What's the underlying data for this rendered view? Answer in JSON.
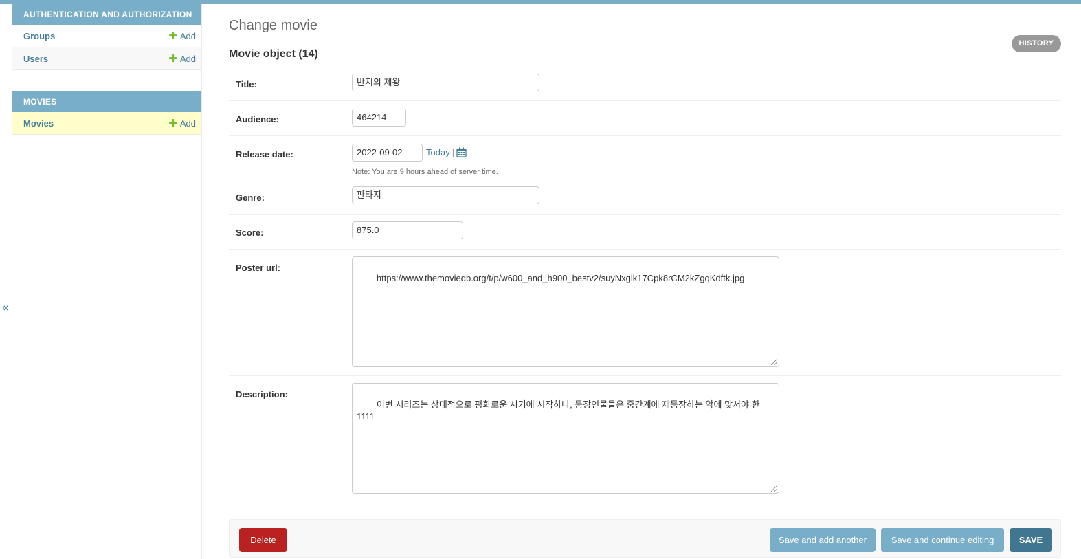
{
  "sidebar": {
    "collapse_glyph": "«",
    "modules": [
      {
        "header": "AUTHENTICATION AND AUTHORIZATION",
        "items": [
          {
            "label": "Groups",
            "add_label": "Add"
          },
          {
            "label": "Users",
            "add_label": "Add"
          }
        ]
      },
      {
        "header": "MOVIES",
        "items": [
          {
            "label": "Movies",
            "add_label": "Add",
            "current": true
          }
        ]
      }
    ]
  },
  "main": {
    "page_title": "Change movie",
    "history_label": "HISTORY",
    "object_title": "Movie object (14)",
    "fields": {
      "title": {
        "label": "Title:",
        "value": "반지의 제왕"
      },
      "audience": {
        "label": "Audience:",
        "value": "464214"
      },
      "release_date": {
        "label": "Release date:",
        "value": "2022-09-02",
        "today_label": "Today",
        "separator": "|",
        "note": "Note: You are 9 hours ahead of server time."
      },
      "genre": {
        "label": "Genre:",
        "value": "판타지"
      },
      "score": {
        "label": "Score:",
        "value": "875.0"
      },
      "poster_url": {
        "label": "Poster url:",
        "value": "https://www.themoviedb.org/t/p/w600_and_h900_bestv2/suyNxglk17Cpk8rCM2kZgqKdftk.jpg"
      },
      "description": {
        "label": "Description:",
        "value": "이번 시리즈는 상대적으로 평화로운 시기에 시작하나, 등장인물들은 중간계에 재등장하는 악에 맞서야 한\n1111"
      }
    }
  },
  "submit_row": {
    "delete_label": "Delete",
    "save_add_another_label": "Save and add another",
    "save_continue_label": "Save and continue editing",
    "save_label": "SAVE"
  },
  "colors": {
    "header_blue": "#79aec8",
    "link_blue": "#447e9b",
    "add_green": "#70bf2b",
    "delete_red": "#ba2121",
    "save_dark_blue": "#417690",
    "current_row_yellow": "#ffffcc"
  },
  "icons": {
    "add": "plus-icon",
    "calendar": "calendar-icon",
    "collapse": "double-chevron-left-icon"
  }
}
